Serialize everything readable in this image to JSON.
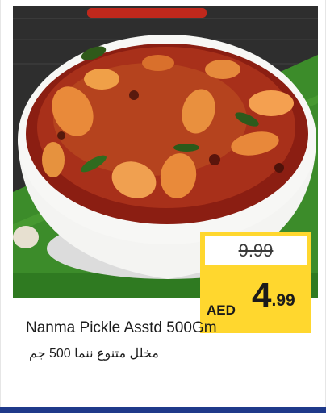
{
  "product": {
    "name": "Nanma Pickle Asstd 500Gm",
    "name_arabic": "مخلل متنوع ننما 500 جم",
    "image_icon": "pickle-bowl-photo"
  },
  "price": {
    "old": "9.99",
    "currency": "AED",
    "new_integer": "4",
    "new_decimal": ".99"
  },
  "colors": {
    "price_box": "#ffd72e",
    "footer_bar": "#1f3a8a"
  }
}
